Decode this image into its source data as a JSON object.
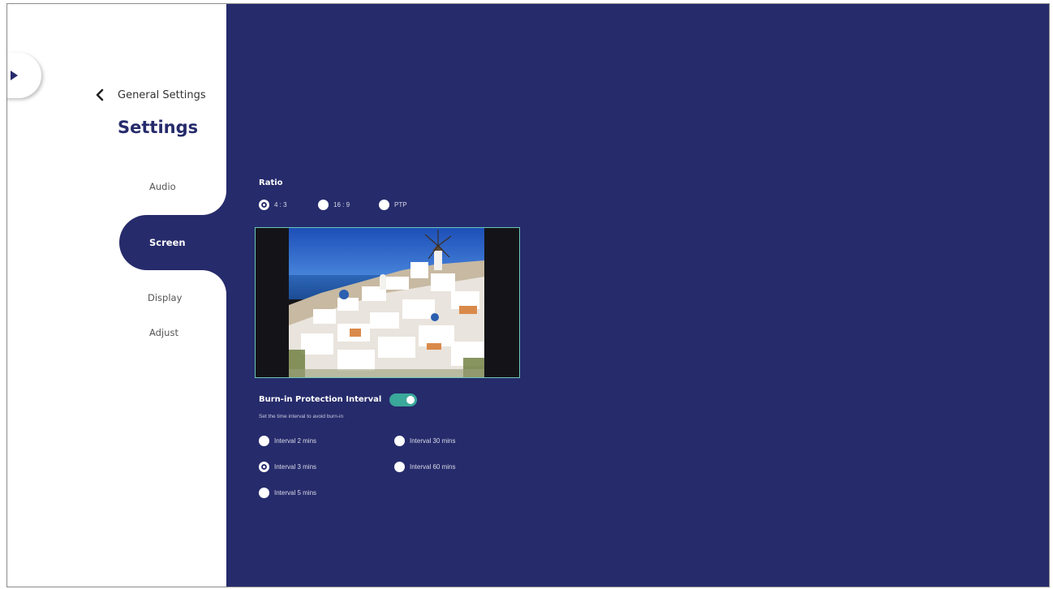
{
  "sidebar": {
    "back_label": "General Settings",
    "title": "Settings",
    "items": [
      {
        "label": "Audio"
      },
      {
        "label": "Screen",
        "active": true
      },
      {
        "label": "Display"
      },
      {
        "label": "Adjust"
      }
    ]
  },
  "ratio": {
    "title": "Ratio",
    "options": [
      {
        "label": "4 : 3",
        "selected": true
      },
      {
        "label": "16 : 9",
        "selected": false
      },
      {
        "label": "PTP",
        "selected": false
      }
    ]
  },
  "burn_in": {
    "title": "Burn-in Protection Interval",
    "enabled": true,
    "description": "Set the time interval to avoid burn-in",
    "options": [
      {
        "label": "Interval 2 mins",
        "selected": false
      },
      {
        "label": "Interval 30 mins",
        "selected": false
      },
      {
        "label": "Interval 3 mins",
        "selected": true
      },
      {
        "label": "Interval 60 mins",
        "selected": false
      },
      {
        "label": "Interval 5 mins",
        "selected": false
      }
    ]
  },
  "colors": {
    "panel": "#262b6b",
    "accent": "#3aa89a",
    "preview_border": "#6ac8b8"
  },
  "icons": [
    "expand-arrow-icon",
    "chevron-left-icon"
  ]
}
